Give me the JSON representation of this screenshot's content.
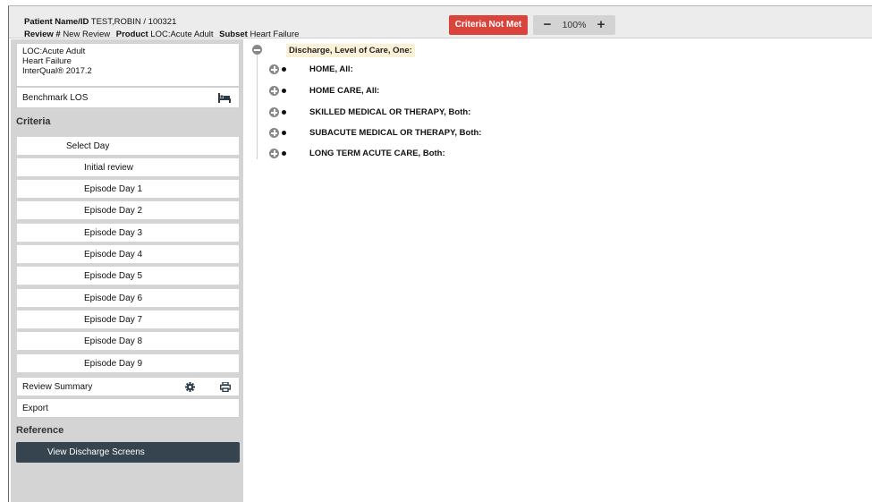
{
  "header": {
    "patient_label": "Patient Name/ID",
    "patient_value": "TEST,ROBIN / 100321",
    "review_label": "Review #",
    "review_value": "New Review",
    "product_label": "Product",
    "product_value": "LOC:Acute Adult",
    "subset_label": "Subset",
    "subset_value": "Heart Failure",
    "status_badge": "Criteria Not Met",
    "zoom_minus": "−",
    "zoom_value": "100%",
    "zoom_plus": "+"
  },
  "sidebar": {
    "info_lines": [
      "LOC:Acute Adult",
      "Heart Failure",
      "InterQual® 2017.2"
    ],
    "benchmark_label": "Benchmark LOS",
    "criteria_heading": "Criteria",
    "select_day": "Select Day",
    "days": [
      "Initial review",
      "Episode Day 1",
      "Episode Day 2",
      "Episode Day 3",
      "Episode Day 4",
      "Episode Day 5",
      "Episode Day 6",
      "Episode Day 7",
      "Episode Day 8",
      "Episode Day 9"
    ],
    "review_summary": "Review Summary",
    "export": "Export",
    "reference_heading": "Reference",
    "view_discharge": "View Discharge Screens"
  },
  "tree": {
    "root": "Discharge, Level of Care, One:",
    "children": [
      "HOME, All:",
      "HOME CARE, All:",
      "SKILLED MEDICAL OR THERAPY, Both:",
      "SUBACUTE MEDICAL OR THERAPY, Both:",
      "LONG TERM ACUTE CARE, Both:"
    ]
  },
  "colors": {
    "status_red": "#d9443c",
    "active_button": "#35444f",
    "root_highlight": "#fbf1d6",
    "sidebar_bg": "#d4d4d4"
  },
  "icons": [
    "bed-icon",
    "gear-icon",
    "print-icon",
    "collapse-icon",
    "expand-icon"
  ]
}
